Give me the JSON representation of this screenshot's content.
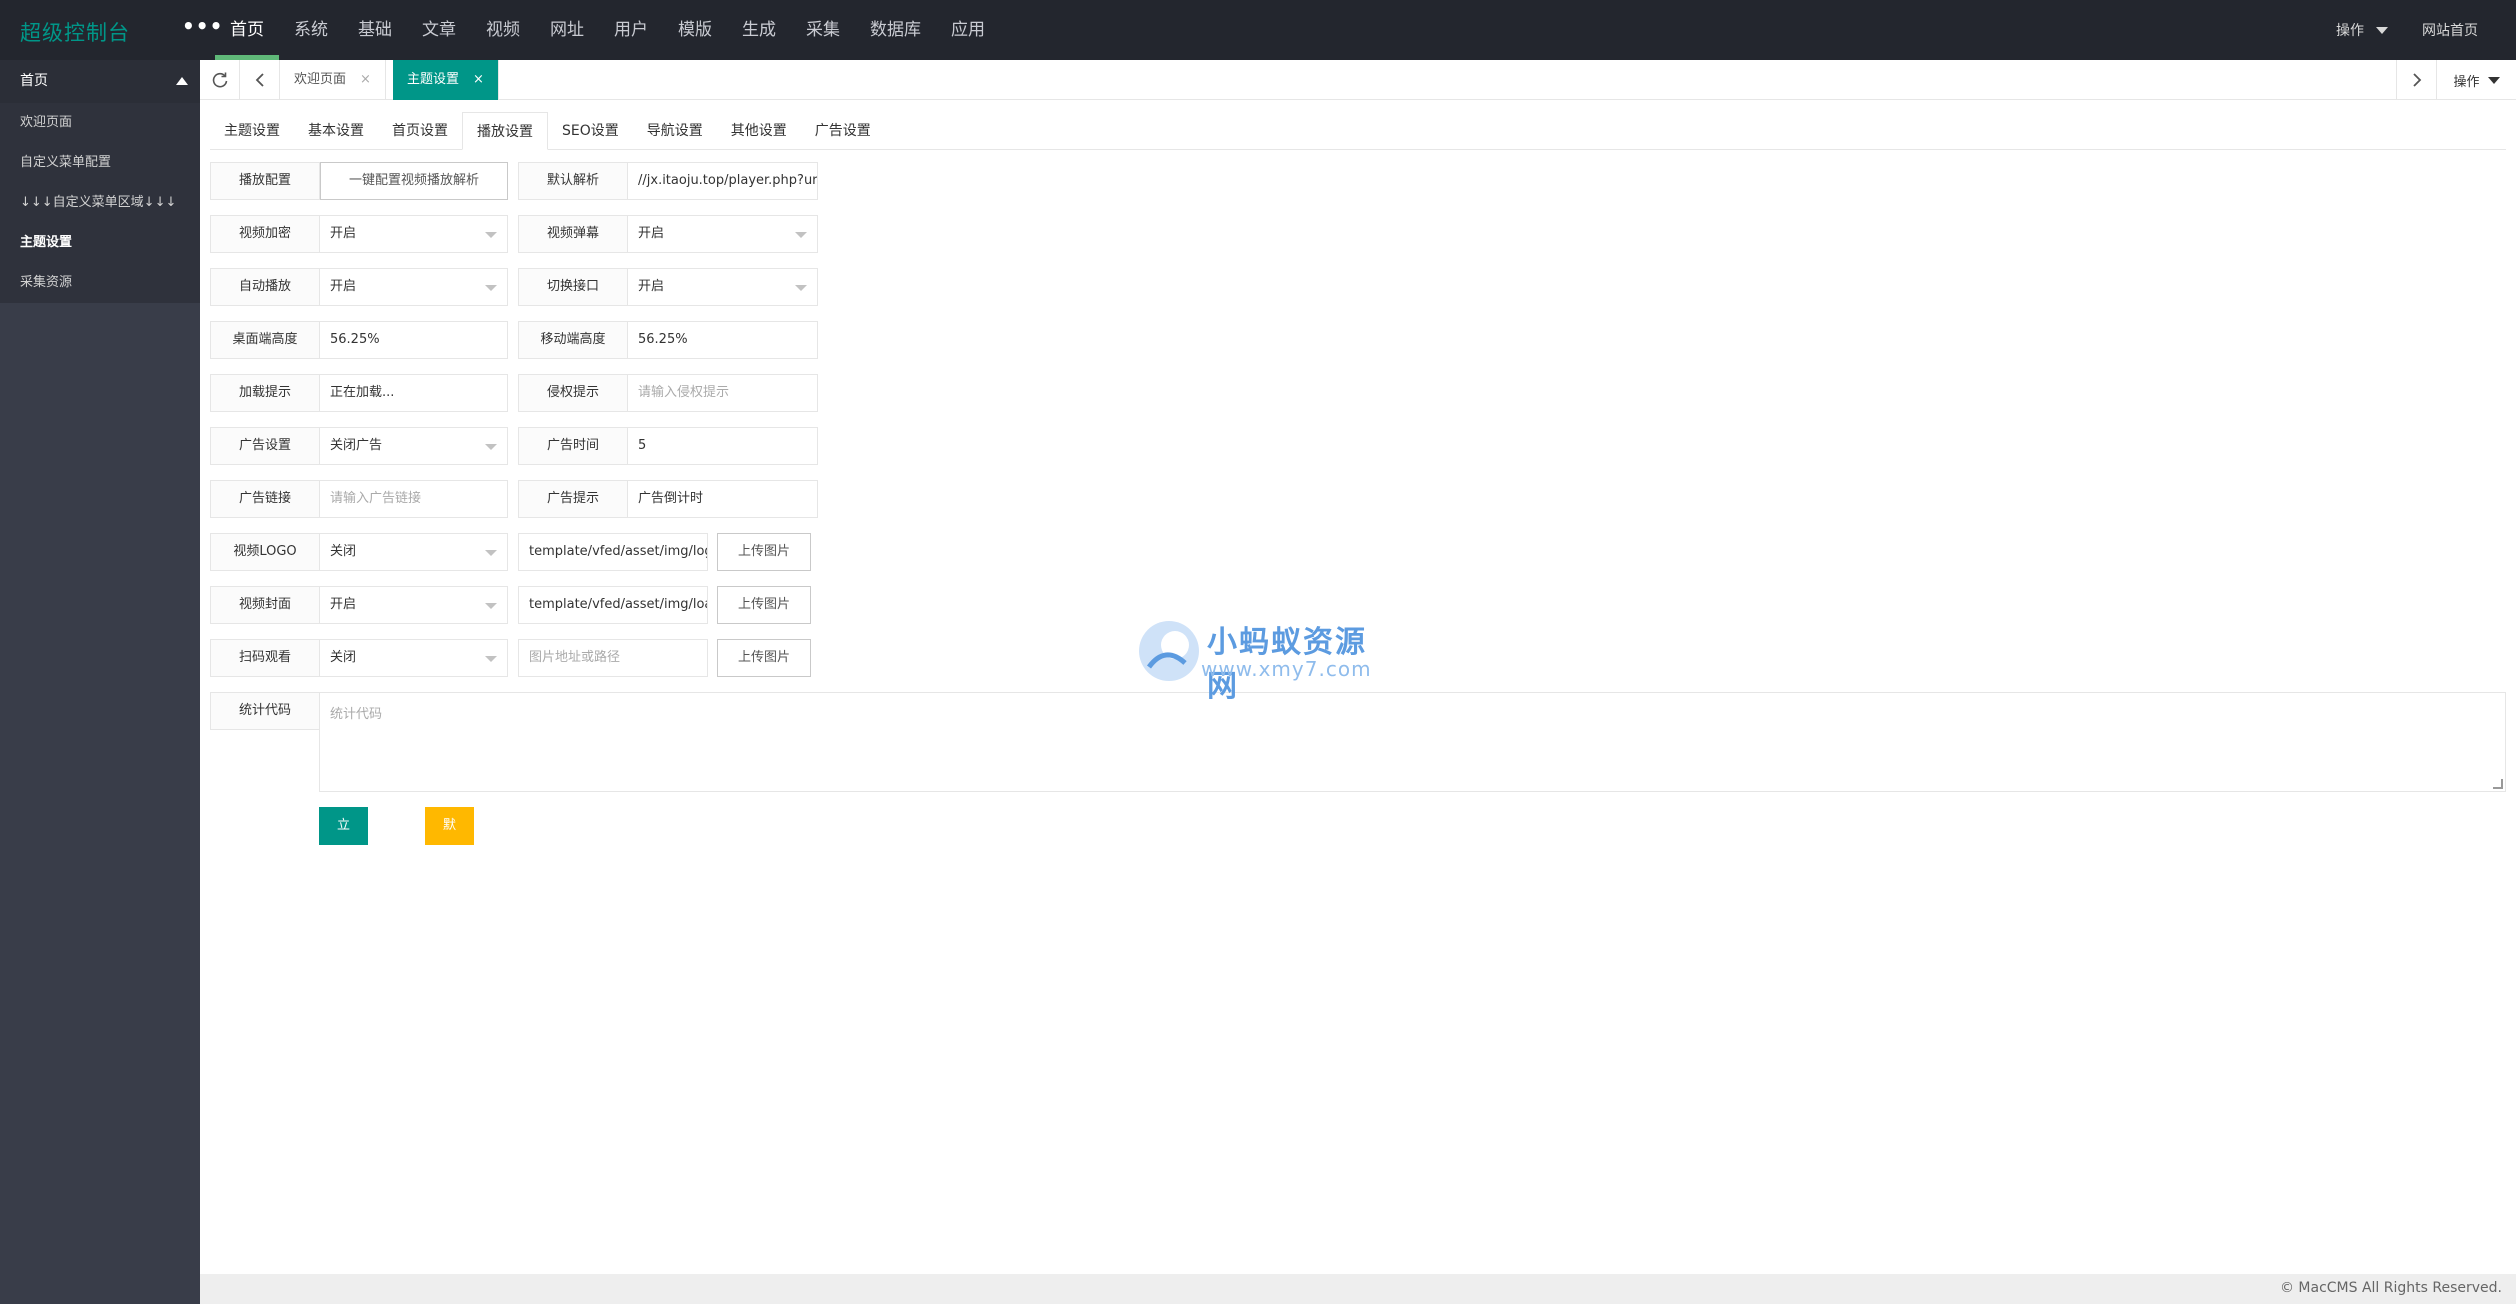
{
  "header": {
    "logo": "超级控制台",
    "more": "•••",
    "nav": [
      "首页",
      "系统",
      "基础",
      "文章",
      "视频",
      "网址",
      "用户",
      "模版",
      "生成",
      "采集",
      "数据库",
      "应用"
    ],
    "ops_label": "操作",
    "site_home": "网站首页"
  },
  "sidebar": {
    "head": "首页",
    "items": [
      "欢迎页面",
      "自定义菜单配置",
      "↓↓↓自定义菜单区域↓↓↓",
      "主题设置",
      "采集资源"
    ]
  },
  "tabbar": {
    "tabs": [
      {
        "label": "欢迎页面",
        "close": "×"
      },
      {
        "label": "主题设置",
        "close": "×"
      }
    ],
    "ops": "操作"
  },
  "subtabs": [
    "主题设置",
    "基本设置",
    "首页设置",
    "播放设置",
    "SEO设置",
    "导航设置",
    "其他设置",
    "广告设置"
  ],
  "form": {
    "play_config": {
      "label": "播放配置",
      "button": "一键配置视频播放解析"
    },
    "default_parse": {
      "label": "默认解析",
      "value": "//jx.itaoju.top/player.php?url="
    },
    "video_encrypt": {
      "label": "视频加密",
      "value": "开启"
    },
    "video_danmaku": {
      "label": "视频弹幕",
      "value": "开启"
    },
    "auto_play": {
      "label": "自动播放",
      "value": "开启"
    },
    "switch_api": {
      "label": "切换接口",
      "value": "开启"
    },
    "desktop_height": {
      "label": "桌面端高度",
      "value": "56.25%"
    },
    "mobile_height": {
      "label": "移动端高度",
      "value": "56.25%"
    },
    "loading_tip": {
      "label": "加载提示",
      "value": "正在加载..."
    },
    "infringe_tip": {
      "label": "侵权提示",
      "placeholder": "请输入侵权提示"
    },
    "ad_setting": {
      "label": "广告设置",
      "value": "关闭广告"
    },
    "ad_time": {
      "label": "广告时间",
      "value": "5"
    },
    "ad_link": {
      "label": "广告链接",
      "placeholder": "请输入广告链接"
    },
    "ad_tip": {
      "label": "广告提示",
      "value": "广告倒计时"
    },
    "video_logo": {
      "label": "视频LOGO",
      "value": "关闭",
      "path": "template/vfed/asset/img/logo",
      "upload": "上传图片"
    },
    "video_cover": {
      "label": "视频封面",
      "value": "开启",
      "path": "template/vfed/asset/img/load",
      "upload": "上传图片"
    },
    "scan_watch": {
      "label": "扫码观看",
      "value": "关闭",
      "path_placeholder": "图片地址或路径",
      "upload": "上传图片"
    },
    "stat_code": {
      "label": "统计代码",
      "placeholder": "统计代码"
    },
    "save": "立即保存",
    "default": "默认设置"
  },
  "watermark": {
    "line1": "小蚂蚁资源网",
    "line2": "www.xmy7.com"
  },
  "footer": "© MacCMS All Rights Reserved."
}
